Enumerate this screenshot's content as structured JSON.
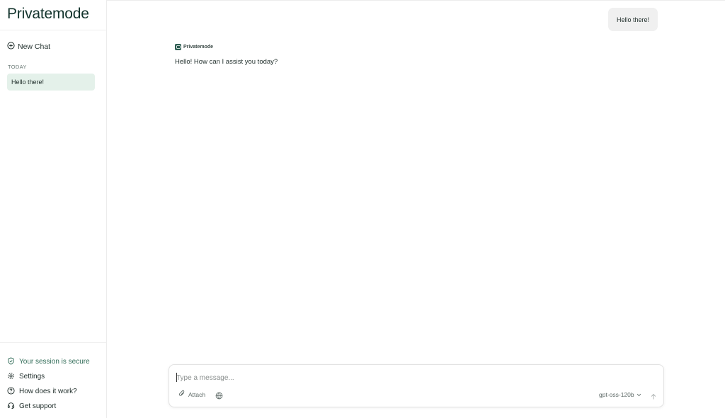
{
  "app": {
    "logo_text": "Privatemode"
  },
  "sidebar": {
    "new_chat_label": "New Chat",
    "section_label": "TODAY",
    "history": [
      {
        "label": "Hello there!"
      }
    ],
    "footer": [
      {
        "label": "Your session is secure",
        "icon": "shield-check-icon"
      },
      {
        "label": "Settings",
        "icon": "gear-icon"
      },
      {
        "label": "How does it work?",
        "icon": "help-circle-icon"
      },
      {
        "label": "Get support",
        "icon": "headset-icon"
      }
    ]
  },
  "conversation": {
    "user_message": "Hello there!",
    "assistant_name": "Privatemode",
    "assistant_message": "Hello! How can I assist you today?"
  },
  "composer": {
    "placeholder": "Type a message...",
    "value": "",
    "attach_label": "Attach",
    "model": "gpt-oss-120b"
  },
  "colors": {
    "accent": "#2f6b56",
    "selected_history_bg": "#e4f1ea",
    "user_bubble_bg": "#f0f0f0"
  }
}
